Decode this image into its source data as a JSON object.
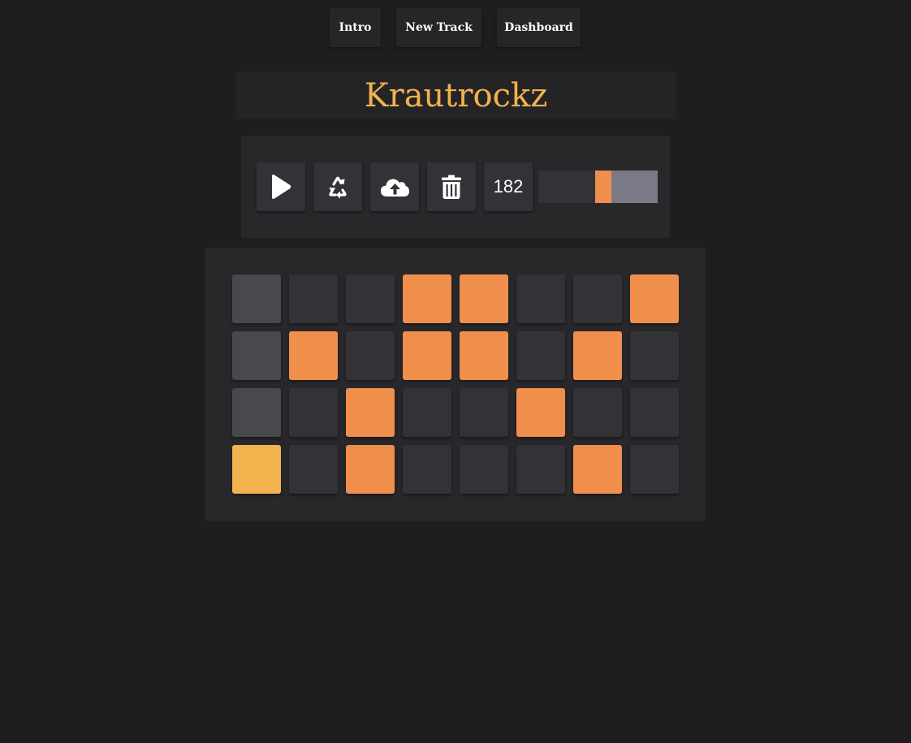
{
  "nav": {
    "items": [
      {
        "label": "Intro"
      },
      {
        "label": "New Track"
      },
      {
        "label": "Dashboard"
      }
    ]
  },
  "track": {
    "title": "Krautrockz"
  },
  "controls": {
    "buttons": [
      {
        "icon": "play-icon"
      },
      {
        "icon": "recycle-icon"
      },
      {
        "icon": "cloud-upload-icon"
      },
      {
        "icon": "trash-icon"
      }
    ],
    "tempo": "182",
    "volume_fraction": 0.55
  },
  "colors": {
    "background": "#1e1e20",
    "accent": "#f2b24d",
    "cell_on": "#f08f4b",
    "cell_off": "#333337",
    "cell_current": "#48484d",
    "cell_current_on": "#f2b24d",
    "slider_remaining": "#7a7a87"
  },
  "sequencer": {
    "current_step": 0,
    "rows": [
      [
        0,
        0,
        0,
        1,
        1,
        0,
        0,
        1
      ],
      [
        0,
        1,
        0,
        1,
        1,
        0,
        1,
        0
      ],
      [
        0,
        0,
        1,
        0,
        0,
        1,
        0,
        0
      ],
      [
        1,
        0,
        1,
        0,
        0,
        0,
        1,
        0
      ]
    ]
  }
}
